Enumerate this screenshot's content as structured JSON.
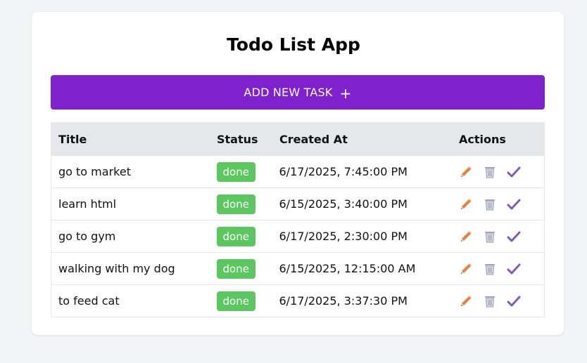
{
  "app": {
    "title": "Todo List App",
    "add_button_label": "ADD NEW TASK",
    "add_button_icon": "+"
  },
  "table": {
    "headers": [
      "Title",
      "Status",
      "Created At",
      "Actions"
    ],
    "rows": [
      {
        "title": "go to market",
        "status": "done",
        "created_at": "6/17/2025, 7:45:00 PM"
      },
      {
        "title": "learn html",
        "status": "done",
        "created_at": "6/15/2025, 3:40:00 PM"
      },
      {
        "title": "go to gym",
        "status": "done",
        "created_at": "6/17/2025, 2:30:00 PM"
      },
      {
        "title": "walking with my dog",
        "status": "done",
        "created_at": "6/15/2025, 12:15:00 AM"
      },
      {
        "title": "to feed cat",
        "status": "done",
        "created_at": "6/17/2025, 3:37:30 PM"
      }
    ],
    "action_icons": [
      "pencil-icon",
      "trash-icon",
      "checkmark-icon"
    ]
  },
  "colors": {
    "accent": "#7e22ce",
    "done_badge": "#5ac85f",
    "header_bg": "#e5e7eb",
    "pencil": "#e07b39",
    "trash": "#9ca3af",
    "check": "#7c5cc4"
  }
}
